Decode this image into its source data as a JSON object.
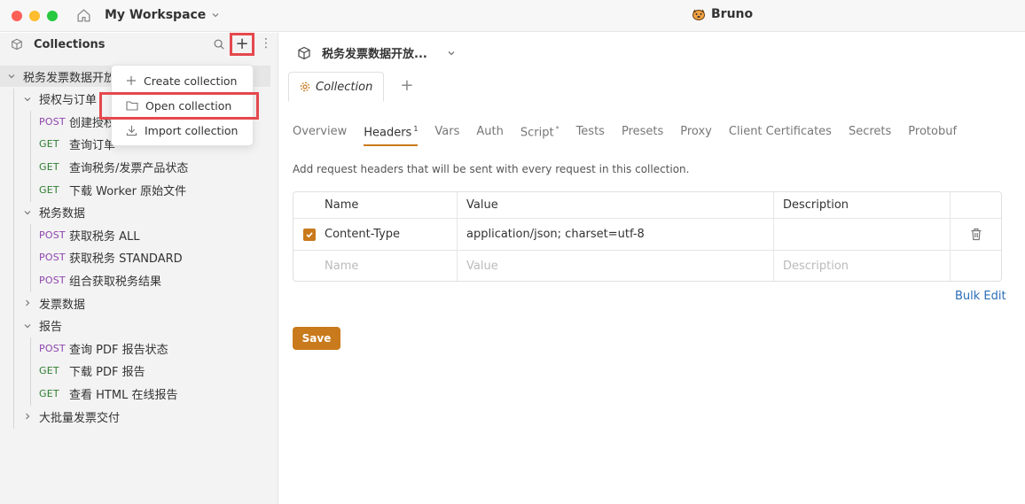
{
  "titlebar": {
    "workspace": "My Workspace",
    "app_title": "Bruno"
  },
  "sidebar": {
    "title": "Collections",
    "tree": {
      "collection": "税务发票数据开放",
      "folders": [
        {
          "name": "授权与订单",
          "requests": [
            {
              "method": "POST",
              "name": "创建授权"
            },
            {
              "method": "GET",
              "name": "查询订单"
            },
            {
              "method": "GET",
              "name": "查询税务/发票产品状态"
            },
            {
              "method": "GET",
              "name": "下载 Worker 原始文件"
            }
          ]
        },
        {
          "name": "税务数据",
          "requests": [
            {
              "method": "POST",
              "name": "获取税务 ALL"
            },
            {
              "method": "POST",
              "name": "获取税务 STANDARD"
            },
            {
              "method": "POST",
              "name": "组合获取税务结果"
            }
          ]
        },
        {
          "name": "发票数据",
          "requests": []
        },
        {
          "name": "报告",
          "requests": [
            {
              "method": "POST",
              "name": "查询 PDF 报告状态"
            },
            {
              "method": "GET",
              "name": "下载 PDF 报告"
            },
            {
              "method": "GET",
              "name": "查看 HTML 在线报告"
            }
          ]
        },
        {
          "name": "大批量发票交付",
          "requests": []
        }
      ]
    }
  },
  "dropdown": {
    "items": [
      "Create collection",
      "Open collection",
      "Import collection"
    ]
  },
  "main": {
    "collection_name": "税务发票数据开放...",
    "tab_label": "Collection",
    "subtabs": [
      "Overview",
      "Headers",
      "Vars",
      "Auth",
      "Script",
      "Tests",
      "Presets",
      "Proxy",
      "Client Certificates",
      "Secrets",
      "Protobuf"
    ],
    "headers_count": "1",
    "script_marker": "*",
    "hint": "Add request headers that will be sent with every request in this collection.",
    "table": {
      "columns": [
        "Name",
        "Value",
        "Description"
      ],
      "rows": [
        {
          "name": "Content-Type",
          "value": "application/json; charset=utf-8",
          "description": ""
        }
      ],
      "placeholders": {
        "name": "Name",
        "value": "Value",
        "description": "Description"
      }
    },
    "bulk_edit": "Bulk Edit",
    "save": "Save"
  }
}
